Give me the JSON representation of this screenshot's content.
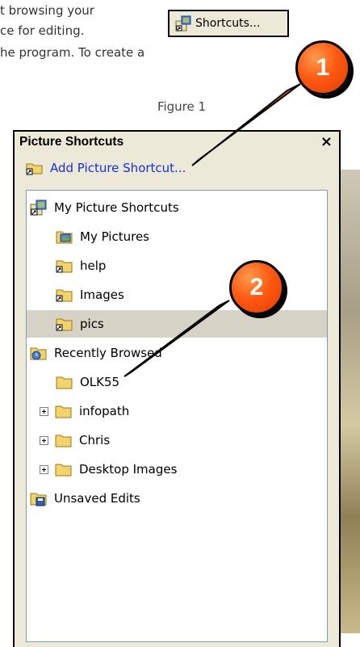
{
  "document": {
    "lines": [
      "t browsing your",
      "ce for editing.",
      "he program.  To create a"
    ],
    "figure_caption": "Figure 1"
  },
  "shortcuts_button": {
    "label": "Shortcuts..."
  },
  "pane": {
    "title": "Picture Shortcuts",
    "close_label": "×",
    "add_link": "Add Picture Shortcut..."
  },
  "tree": [
    {
      "label": "My Picture Shortcuts",
      "icon": "shortcuts-folder-icon"
    },
    {
      "label": "My Pictures",
      "icon": "pictures-folder-icon"
    },
    {
      "label": "help",
      "icon": "folder-shortcut-icon"
    },
    {
      "label": "Images",
      "icon": "folder-shortcut-icon"
    },
    {
      "label": "pics",
      "icon": "folder-shortcut-icon",
      "selected": true
    },
    {
      "label": "Recently Browsed",
      "icon": "recent-folder-icon"
    },
    {
      "label": "OLK55",
      "icon": "folder-icon"
    },
    {
      "label": "infopath",
      "icon": "folder-icon",
      "expander": "+"
    },
    {
      "label": "Chris",
      "icon": "folder-icon",
      "expander": "+"
    },
    {
      "label": "Desktop Images",
      "icon": "folder-icon",
      "expander": "+"
    },
    {
      "label": "Unsaved Edits",
      "icon": "unsaved-folder-icon"
    }
  ],
  "callouts": [
    "1",
    "2"
  ],
  "colors": {
    "link": "#1530d8",
    "pane_bg": "#ECE9D8",
    "callout": "#ff5a12",
    "selection": "#d6d2c5"
  }
}
